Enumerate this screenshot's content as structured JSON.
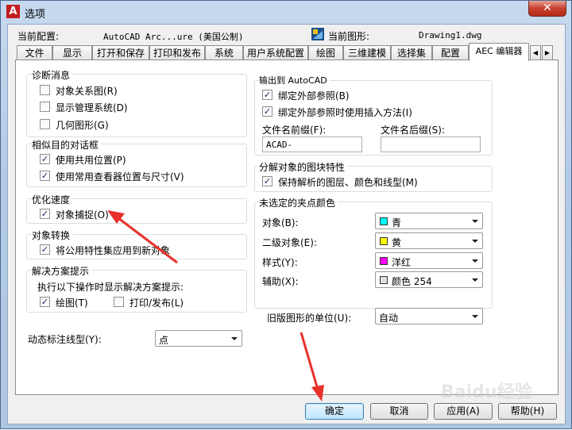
{
  "window": {
    "title": "选项",
    "app_icon": "A",
    "close_glyph": "✕"
  },
  "header": {
    "profile_label": "当前配置:",
    "profile_value": "AutoCAD Arc...ure (美国公制)",
    "drawing_label": "当前图形:",
    "drawing_value": "Drawing1.dwg"
  },
  "tabs": [
    "文件",
    "显示",
    "打开和保存",
    "打印和发布",
    "系统",
    "用户系统配置",
    "绘图",
    "三维建模",
    "选择集",
    "配置",
    "AEC 编辑器"
  ],
  "tab_scroll": {
    "left": "◀",
    "right": "▶"
  },
  "diagnostics": {
    "title": "诊断消息",
    "items": [
      {
        "label": "对象关系图(R)",
        "checked": false
      },
      {
        "label": "显示管理系统(D)",
        "checked": false
      },
      {
        "label": "几何图形(G)",
        "checked": false
      }
    ]
  },
  "similar_dialogs": {
    "title": "相似目的对话框",
    "items": [
      {
        "label": "使用共用位置(P)",
        "checked": true
      },
      {
        "label": "使用常用查看器位置与尺寸(V)",
        "checked": true
      }
    ]
  },
  "optimize": {
    "title": "优化速度",
    "items": [
      {
        "label": "对象捕捉(O)",
        "checked": true
      }
    ]
  },
  "object_conversion": {
    "title": "对象转换",
    "items": [
      {
        "label": "将公用特性集应用到新对象",
        "checked": true
      }
    ]
  },
  "solution_tips": {
    "title": "解决方案提示",
    "subtitle": "执行以下操作时显示解决方案提示:",
    "items": [
      {
        "label": "绘图(T)",
        "checked": true
      },
      {
        "label": "打印/发布(L)",
        "checked": false
      }
    ]
  },
  "dim_linetype": {
    "label": "动态标注线型(Y):",
    "value": "点"
  },
  "export_autocad": {
    "title": "输出到 AutoCAD",
    "items": [
      {
        "label": "绑定外部参照(B)",
        "checked": true
      },
      {
        "label": "绑定外部参照时使用插入方法(I)",
        "checked": true
      }
    ],
    "prefix_label": "文件名前缀(F):",
    "prefix_value": "ACAD-",
    "suffix_label": "文件名后缀(S):",
    "suffix_value": ""
  },
  "explode": {
    "title": "分解对象的图块特性",
    "items": [
      {
        "label": "保持解析的图层、颜色和线型(M)",
        "checked": true
      }
    ]
  },
  "grip_colors": {
    "title": "未选定的夹点颜色",
    "rows": [
      {
        "label": "对象(B):",
        "value": "青",
        "color": "#00ffff"
      },
      {
        "label": "二级对象(E):",
        "value": "黄",
        "color": "#ffff00"
      },
      {
        "label": "样式(Y):",
        "value": "洋红",
        "color": "#ff00ff"
      },
      {
        "label": "辅助(X):",
        "value": "颜色 254",
        "color": "#e0e0e0"
      }
    ]
  },
  "legacy_units": {
    "label": "旧版图形的单位(U):",
    "value": "自动"
  },
  "buttons": {
    "ok": "确定",
    "cancel": "取消",
    "apply": "应用(A)",
    "help": "帮助(H)"
  },
  "watermark": "Baidu经验",
  "colors": {
    "accent_arrow": "#e8312b",
    "check": "#1c2d60"
  }
}
